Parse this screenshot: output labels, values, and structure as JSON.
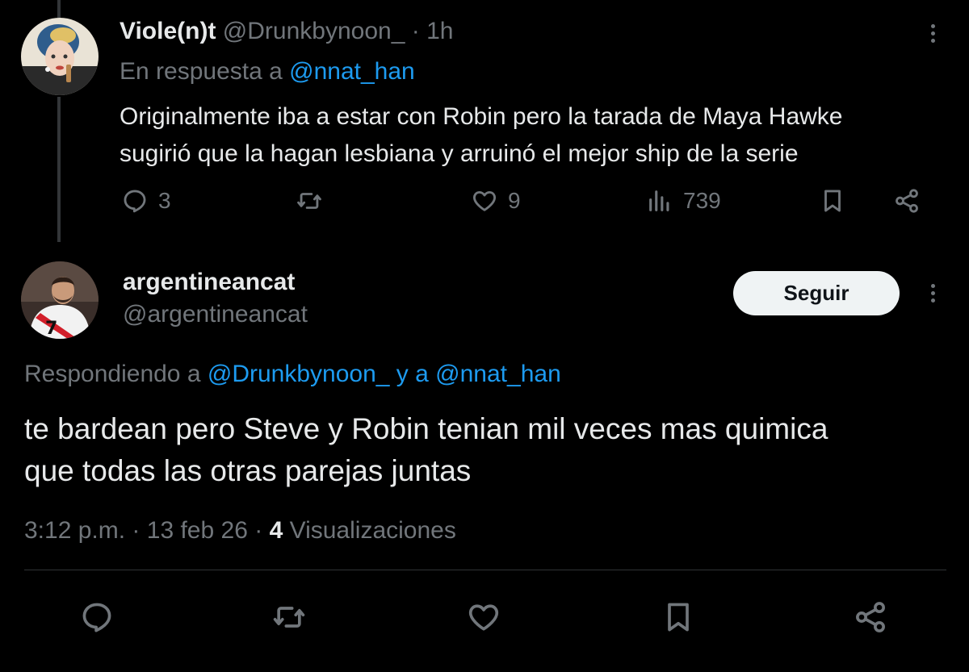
{
  "tweet1": {
    "display_name": "Viole(n)t",
    "handle": "@Drunkbynoon_",
    "separator": "·",
    "time": "1h",
    "reply_prefix": "En respuesta a",
    "reply_to": "@nnat_han",
    "text_line1": "Originalmente iba a estar con Robin pero la tarada de Maya Hawke",
    "text_line2": "sugirió que la hagan lesbiana y arruinó el mejor ship de la serie",
    "replies": "3",
    "likes": "9",
    "views": "739"
  },
  "tweet2": {
    "display_name": "argentineancat",
    "handle": "@argentineancat",
    "follow_label": "Seguir",
    "reply_prefix": "Respondiendo a",
    "reply_to_1": "@Drunkbynoon_",
    "reply_join": "y a",
    "reply_to_2": "@nnat_han",
    "text_line1": "te bardean pero Steve y Robin tenian mil veces mas quimica",
    "text_line2": "que todas las otras parejas juntas",
    "time": "3:12 p.m.",
    "sep1": "·",
    "date": "13 feb 26",
    "sep2": "·",
    "view_count": "4",
    "view_label": "Visualizaciones"
  },
  "icons": {
    "reply": "reply-icon",
    "retweet": "retweet-icon",
    "like": "heart-icon",
    "views": "views-icon",
    "bookmark": "bookmark-icon",
    "share": "share-icon",
    "more": "more-icon"
  },
  "colors": {
    "background": "#000000",
    "text": "#e7e9ea",
    "muted": "#71767b",
    "link": "#1d9bf0",
    "button_bg": "#eff3f4"
  }
}
